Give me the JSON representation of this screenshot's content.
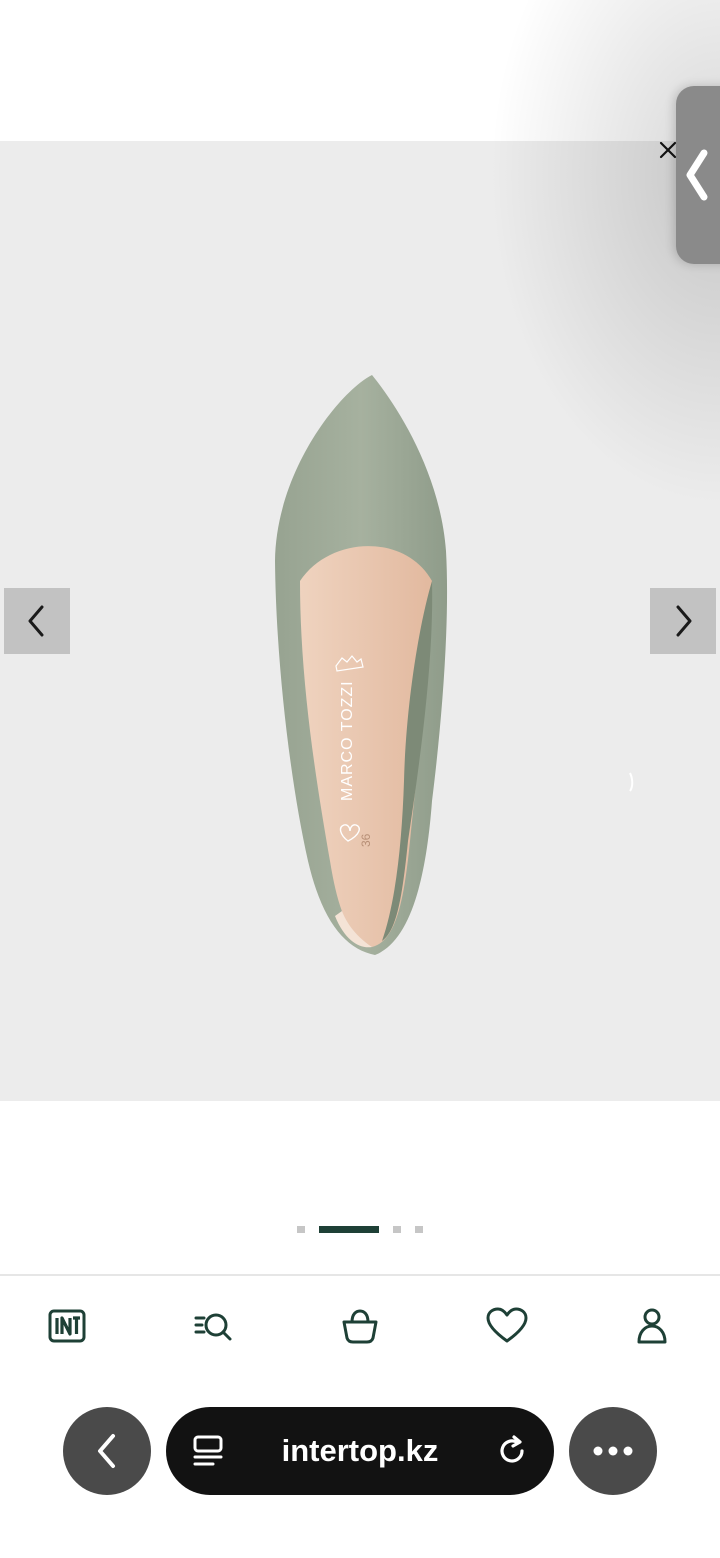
{
  "product_image": {
    "brand_imprint": "MARCO TOZZI",
    "size_imprint": "36"
  },
  "gallery": {
    "slide_count": 4,
    "active_slide": 2
  },
  "bottom_nav": {
    "items": [
      {
        "icon": "int-logo-icon"
      },
      {
        "icon": "search-catalog-icon"
      },
      {
        "icon": "basket-icon"
      },
      {
        "icon": "heart-icon"
      },
      {
        "icon": "profile-icon"
      }
    ]
  },
  "browser": {
    "url": "intertop.kz"
  },
  "colors": {
    "accent": "#1e4036",
    "gallery_bg": "#ececec",
    "url_bar_bg": "#121212"
  }
}
